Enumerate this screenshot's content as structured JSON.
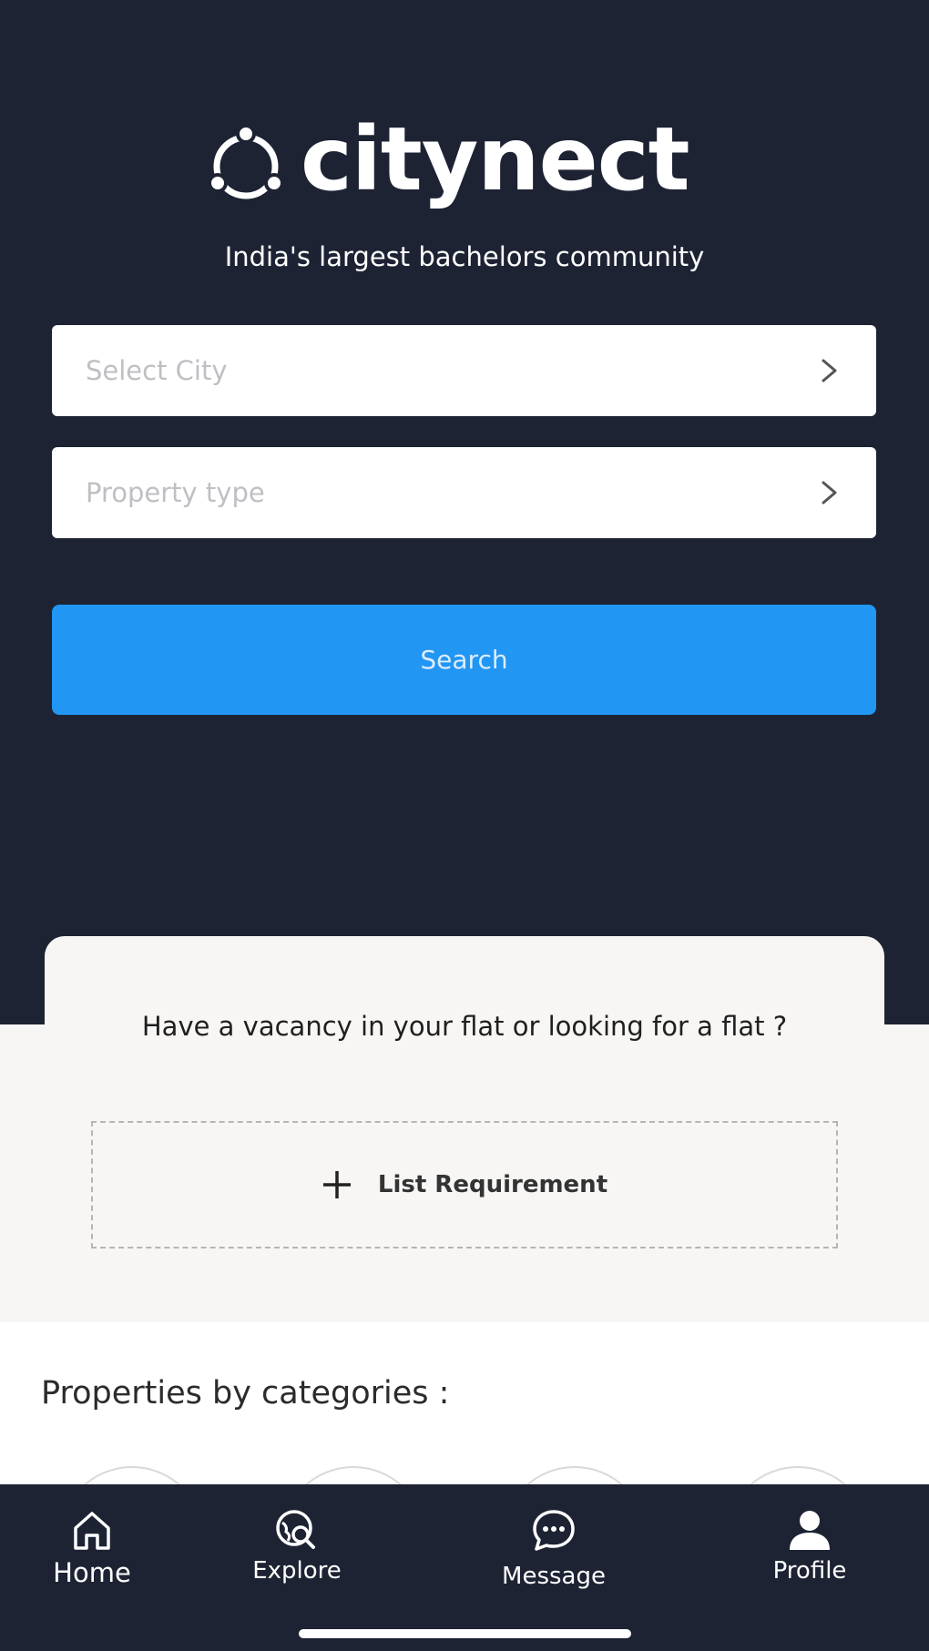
{
  "app": {
    "logo_text": "citynect",
    "tagline": "India's largest bachelors community"
  },
  "search_form": {
    "city_placeholder": "Select City",
    "property_placeholder": "Property type",
    "search_label": "Search"
  },
  "cta": {
    "question": "Have a vacancy in your flat or looking for a flat ?",
    "list_label": "List Requirement"
  },
  "categories": {
    "title": "Properties by categories :"
  },
  "bottom_nav": {
    "items": [
      {
        "label": "Home",
        "icon": "home-icon"
      },
      {
        "label": "Explore",
        "icon": "explore-icon"
      },
      {
        "label": "Message",
        "icon": "message-icon"
      },
      {
        "label": "Profile",
        "icon": "profile-icon"
      }
    ]
  },
  "colors": {
    "background_dark": "#1d2333",
    "accent": "#2196f3",
    "light_section": "#f7f6f4"
  }
}
